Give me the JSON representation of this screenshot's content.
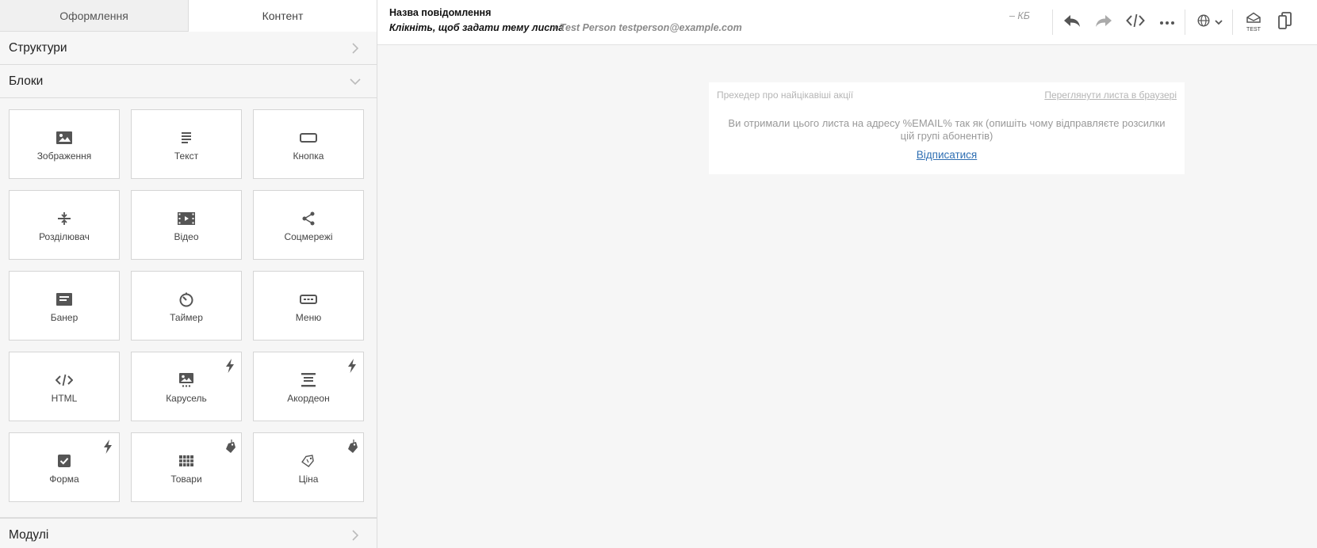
{
  "tabs": [
    {
      "label": "Оформлення",
      "active": false
    },
    {
      "label": "Контент",
      "active": true
    }
  ],
  "sections": {
    "structures": "Структури",
    "blocks": "Блоки",
    "modules": "Модулі"
  },
  "blocks": [
    {
      "label": "Зображення",
      "icon": "image-icon"
    },
    {
      "label": "Текст",
      "icon": "text-icon"
    },
    {
      "label": "Кнопка",
      "icon": "button-icon"
    },
    {
      "label": "Розділювач",
      "icon": "divider-icon"
    },
    {
      "label": "Відео",
      "icon": "video-icon"
    },
    {
      "label": "Соцмережі",
      "icon": "share-icon"
    },
    {
      "label": "Банер",
      "icon": "banner-icon"
    },
    {
      "label": "Таймер",
      "icon": "timer-icon"
    },
    {
      "label": "Меню",
      "icon": "menu-icon"
    },
    {
      "label": "HTML",
      "icon": "code-icon"
    },
    {
      "label": "Карусель",
      "icon": "carousel-icon",
      "badge": "lightning-icon"
    },
    {
      "label": "Акордеон",
      "icon": "accordion-icon",
      "badge": "lightning-icon"
    },
    {
      "label": "Форма",
      "icon": "checkbox-icon",
      "badge": "lightning-icon"
    },
    {
      "label": "Товари",
      "icon": "products-icon",
      "badge": "tag-icon"
    },
    {
      "label": "Ціна",
      "icon": "price-icon",
      "badge": "tag-icon"
    }
  ],
  "topbar": {
    "title": "Назва повідомлення",
    "subject_placeholder": "Клікніть, щоб задати тему листа",
    "sender": "• Test Person testperson@example.com",
    "size": "– КБ",
    "test_label": "TEST"
  },
  "email": {
    "preheader": "Прехедер про найцікавіші акції",
    "view_in_browser": "Переглянути листа в браузері",
    "notice": "Ви отримали цього листа на адресу %EMAIL% так як (опишіть чому відправляєте розсилки цій групі абонентів)",
    "unsubscribe": "Відписатися"
  },
  "colors": {
    "icon": "#555555",
    "link": "#2f6fb3",
    "muted": "#b5b5b5"
  }
}
